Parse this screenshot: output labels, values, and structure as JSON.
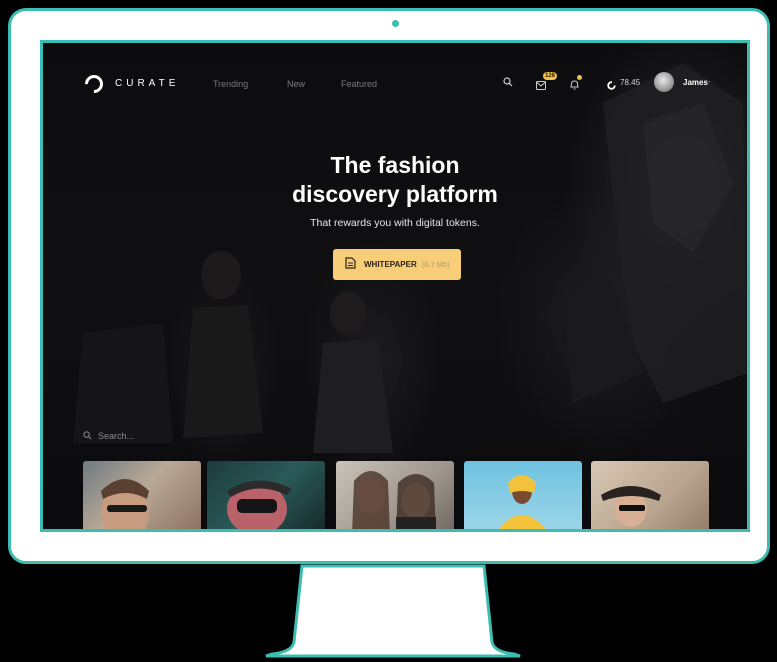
{
  "brand": {
    "name": "CURATE",
    "accent": "#3dbdb1"
  },
  "nav": {
    "links": [
      "Trending",
      "New",
      "Featured"
    ],
    "messages_badge": "126",
    "balance": "78.45",
    "user_name": "James",
    "user_menu_caret": "·"
  },
  "hero": {
    "title_line1": "The fashion",
    "title_line2": "discovery platform",
    "subtitle": "That rewards you with digital tokens.",
    "cta_label": "WHITEPAPER",
    "cta_size": "(6.7 Mb)",
    "cta_color": "#f7cd78"
  },
  "search": {
    "placeholder": "Search..."
  },
  "icons": [
    "search-icon",
    "messages-icon",
    "notifications-icon",
    "token-icon",
    "document-icon"
  ],
  "thumbnails": [
    {
      "name": "man with glasses"
    },
    {
      "name": "man in sunglasses red"
    },
    {
      "name": "two women"
    },
    {
      "name": "woman in yellow hoodie"
    },
    {
      "name": "woman with hat"
    }
  ]
}
